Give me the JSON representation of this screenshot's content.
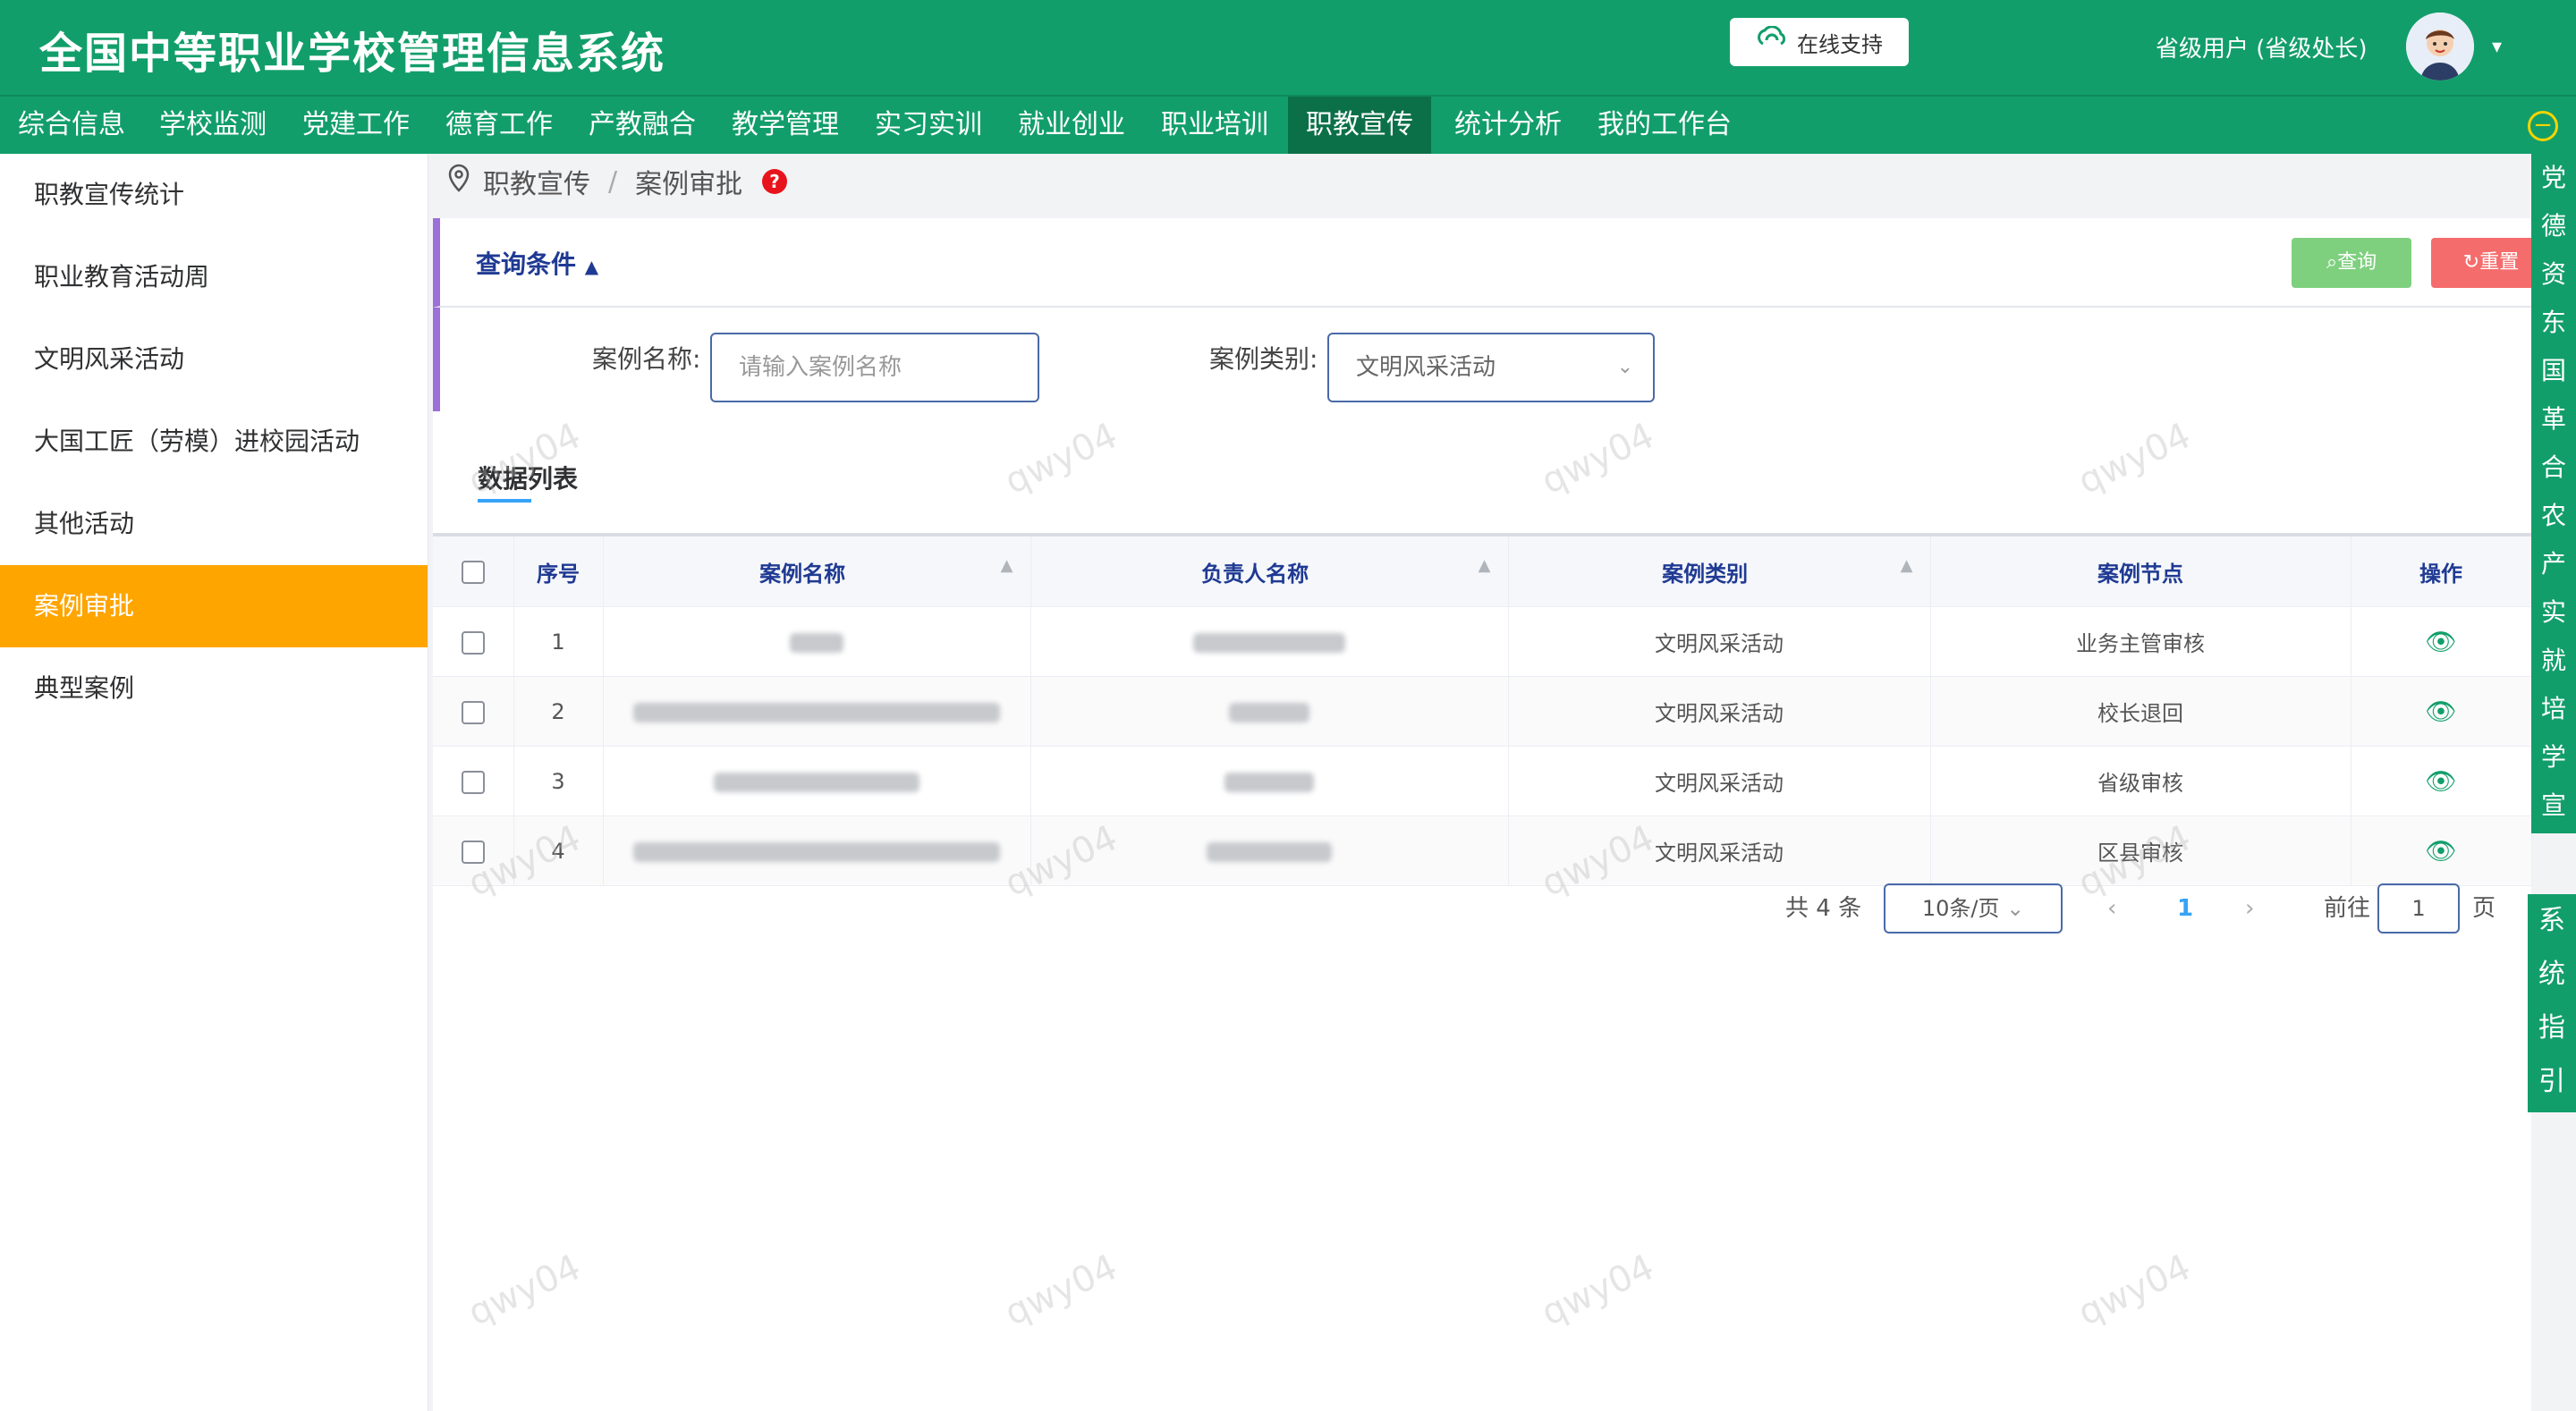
{
  "header": {
    "title": "全国中等职业学校管理信息系统",
    "support_label": "在线支持",
    "user_label": "省级用户 (省级处长)",
    "caret": "▾"
  },
  "nav": {
    "items": [
      "综合信息",
      "学校监测",
      "党建工作",
      "德育工作",
      "产教融合",
      "教学管理",
      "实习实训",
      "就业创业",
      "职业培训",
      "职教宣传",
      "统计分析",
      "我的工作台"
    ],
    "active": "职教宣传"
  },
  "sidebar": {
    "items": [
      "职教宣传统计",
      "职业教育活动周",
      "文明风采活动",
      "大国工匠（劳模）进校园活动",
      "其他活动",
      "案例审批",
      "典型案例"
    ],
    "active": "案例审批"
  },
  "breadcrumb": {
    "level1": "职教宣传",
    "sep": "/",
    "level2": "案例审批",
    "help": "?"
  },
  "query": {
    "title": "查询条件",
    "query_button": "查询",
    "reset_button": "重置",
    "case_name_label": "案例名称:",
    "case_name_placeholder": "请输入案例名称",
    "case_type_label": "案例类别:",
    "case_type_value": "文明风采活动"
  },
  "list": {
    "tab": "数据列表",
    "columns": [
      "序号",
      "案例名称",
      "负责人名称",
      "案例类别",
      "案例节点",
      "操作"
    ],
    "rows": [
      {
        "index": "1",
        "type": "文明风采活动",
        "node": "业务主管审核"
      },
      {
        "index": "2",
        "type": "文明风采活动",
        "node": "校长退回"
      },
      {
        "index": "3",
        "type": "文明风采活动",
        "node": "省级审核"
      },
      {
        "index": "4",
        "type": "文明风采活动",
        "node": "区县审核"
      }
    ]
  },
  "pagination": {
    "total": "共 4 条",
    "page_size": "10条/页",
    "prev": "‹",
    "current": "1",
    "next": "›",
    "goto_label": "前往",
    "goto_value": "1",
    "page_suffix": "页"
  },
  "right_strip": [
    "党",
    "德",
    "资",
    "东",
    "国",
    "革",
    "合",
    "农",
    "产",
    "实",
    "就",
    "培",
    "学",
    "宣"
  ],
  "guide_strip": [
    "系",
    "统",
    "指",
    "引"
  ],
  "watermark": "qwy04",
  "colors": {
    "brand": "#129e6a",
    "active_side": "#ffa500",
    "query_btn": "#7ed07e",
    "reset_btn": "#f56c6c"
  }
}
